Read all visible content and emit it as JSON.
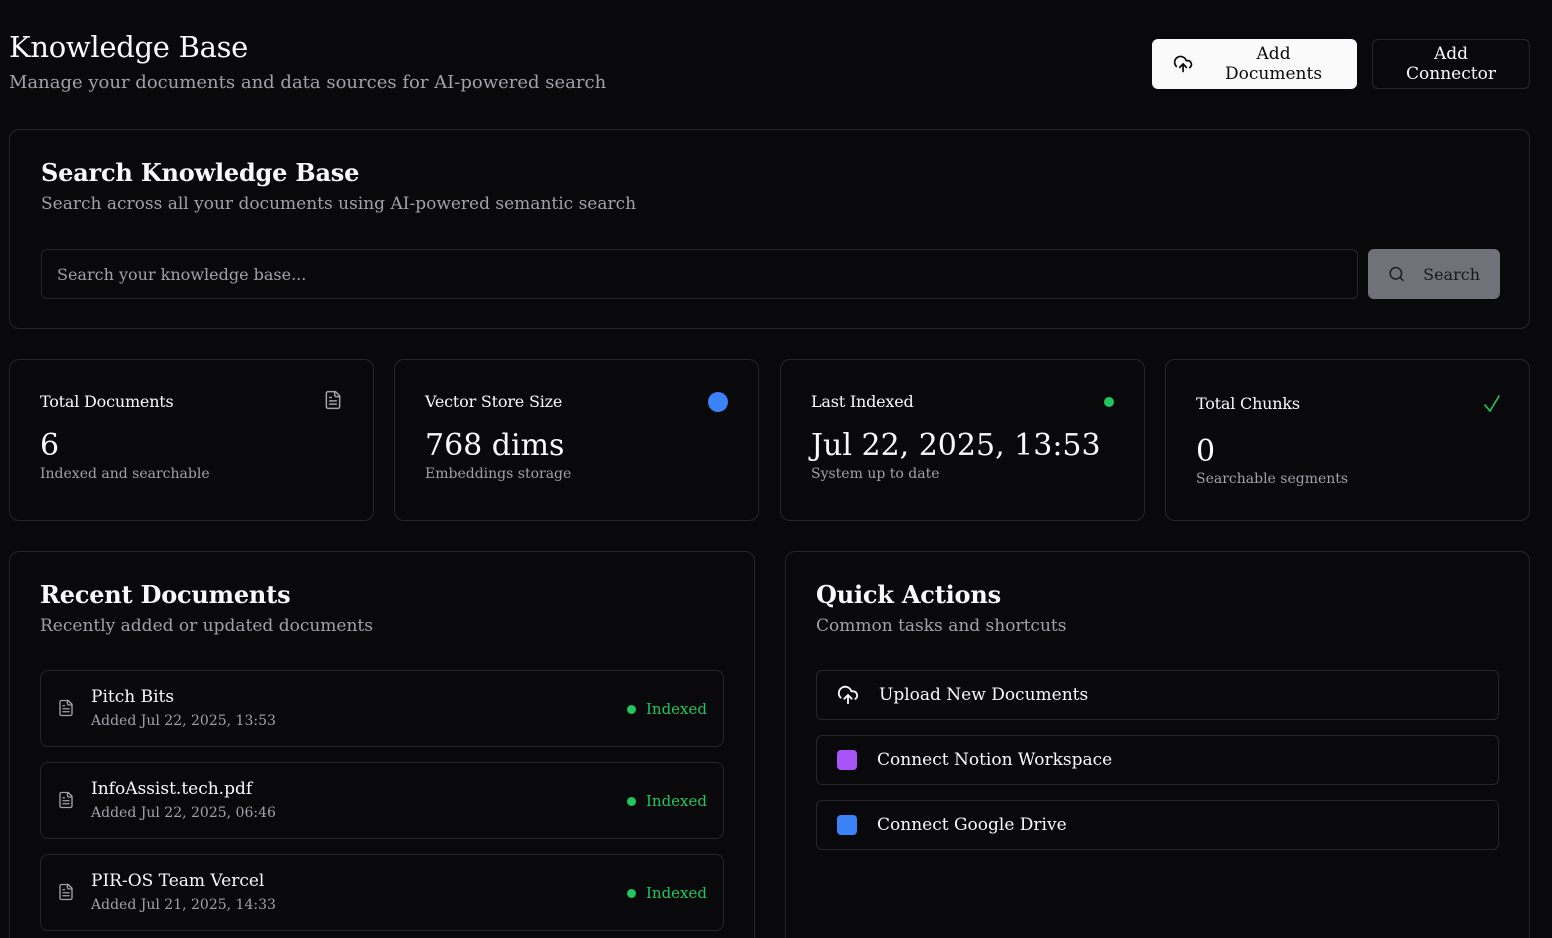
{
  "header": {
    "title": "Knowledge Base",
    "subtitle": "Manage your documents and data sources for AI-powered search",
    "add_documents_label": "Add Documents",
    "add_connector_label": "Add Connector"
  },
  "search": {
    "title": "Search Knowledge Base",
    "subtitle": "Search across all your documents using AI-powered semantic search",
    "placeholder": "Search your knowledge base...",
    "button_label": "Search"
  },
  "stats": [
    {
      "label": "Total Documents",
      "value": "6",
      "note": "Indexed and searchable",
      "icon": "document-icon"
    },
    {
      "label": "Vector Store Size",
      "value": "768 dims",
      "note": "Embeddings storage",
      "icon": "blue-dot-icon",
      "color": "#3b82f6"
    },
    {
      "label": "Last Indexed",
      "value": "Jul 22, 2025, 13:53",
      "note": "System up to date",
      "icon": "green-dot-icon",
      "color": "#22c55e"
    },
    {
      "label": "Total Chunks",
      "value": "0",
      "note": "Searchable segments",
      "icon": "check-icon",
      "color": "#22c55e"
    }
  ],
  "recent": {
    "title": "Recent Documents",
    "subtitle": "Recently added or updated documents",
    "items": [
      {
        "name": "Pitch Bits",
        "date": "Added Jul 22, 2025, 13:53",
        "status": "Indexed"
      },
      {
        "name": "InfoAssist.tech.pdf",
        "date": "Added Jul 22, 2025, 06:46",
        "status": "Indexed"
      },
      {
        "name": "PIR-OS Team Vercel",
        "date": "Added Jul 21, 2025, 14:33",
        "status": "Indexed"
      }
    ]
  },
  "quick_actions": {
    "title": "Quick Actions",
    "subtitle": "Common tasks and shortcuts",
    "items": [
      {
        "label": "Upload New Documents",
        "icon": "upload-cloud-icon"
      },
      {
        "label": "Connect Notion Workspace",
        "icon": "notion-square-icon",
        "color": "#a855f7"
      },
      {
        "label": "Connect Google Drive",
        "icon": "drive-square-icon",
        "color": "#3b82f6"
      }
    ]
  }
}
